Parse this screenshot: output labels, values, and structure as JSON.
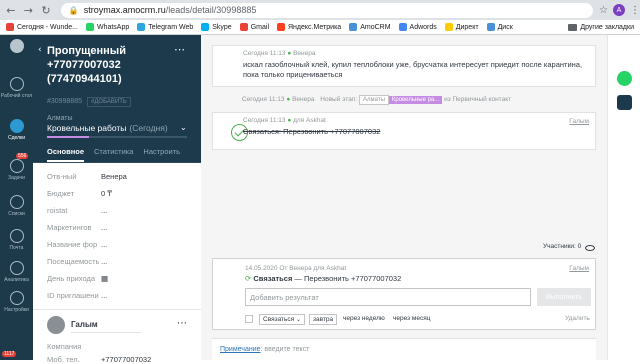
{
  "browser": {
    "url_domain": "stroymax.amocrm.ru",
    "url_path": "/leads/detail/30998885",
    "profile_initial": "A",
    "bookmarks": [
      {
        "label": "Сегодня - Wunde...",
        "color": "#e5423a"
      },
      {
        "label": "WhatsApp",
        "color": "#25d366"
      },
      {
        "label": "Telegram Web",
        "color": "#2ca5e0"
      },
      {
        "label": "Skype",
        "color": "#00aff0"
      },
      {
        "label": "Gmail",
        "color": "#ea4335"
      },
      {
        "label": "Яндекс.Метрика",
        "color": "#fc3f1d"
      },
      {
        "label": "AmoCRM",
        "color": "#4a90d9"
      },
      {
        "label": "Adwords",
        "color": "#4285f4"
      },
      {
        "label": "Директ",
        "color": "#ffcc00"
      },
      {
        "label": "Диск",
        "color": "#4a90d9"
      }
    ],
    "other_bookmarks": "Другие закладки"
  },
  "leftnav": {
    "items": [
      {
        "label": "Рабочий стол"
      },
      {
        "label": "Сделки"
      },
      {
        "label": "Задачи",
        "badge": "556"
      },
      {
        "label": "Списки"
      },
      {
        "label": "Почта"
      },
      {
        "label": "Аналитика"
      },
      {
        "label": "Настройки"
      }
    ],
    "bottom_badge": "1117"
  },
  "lead": {
    "title": "Пропущенный +77077007032 (77470944101)",
    "id": "#30998885",
    "tag_button": "#ДОБАВИТЬ",
    "pipeline": "Алматы",
    "stage": "Кровельные работы",
    "stage_date": "(Сегодня)",
    "stage_progress": 0.3,
    "tabs": [
      "Основное",
      "Статистика",
      "Настроить"
    ],
    "fields": [
      {
        "label": "Отв-ный",
        "value": "Венера"
      },
      {
        "label": "Бюджет",
        "value": "0 ₸"
      },
      {
        "label": "roistat",
        "value": "..."
      },
      {
        "label": "Маркетингов",
        "value": "..."
      },
      {
        "label": "Название фор",
        "value": "..."
      },
      {
        "label": "Посещаемость",
        "value": "..."
      },
      {
        "label": "День прихода",
        "value": "▦"
      },
      {
        "label": "ID приглашени",
        "value": "..."
      }
    ],
    "contact_name": "Галым",
    "contact_company_label": "Компания",
    "contact_phone_label": "Моб. тел.",
    "contact_phone": "+77077007032"
  },
  "feed": {
    "note": {
      "time": "Сегодня 11:13",
      "author": "Венера",
      "text": "искал газоблочный клей, купил теплоблоки уже, брусчатка интересует приедит после карантина, пока только прицениваеться"
    },
    "stage_change": {
      "time": "Сегодня 11:13",
      "author": "Венера",
      "label": "Новый этап:",
      "pipeline": "Алматы",
      "stage": "Кровельные ра...",
      "from": "из Первичный контакт"
    },
    "done_task": {
      "time": "Сегодня 11:13",
      "for": "для Askhat",
      "text": "Связаться: Перезвонить +77077007032",
      "assignee": "Галым"
    },
    "participants": "Участники: 0",
    "open_task": {
      "date": "14.05.2020",
      "from": "От Венера для Askhat",
      "type": "Связаться",
      "text": "— Перезвонить +77077007032",
      "assignee": "Галым"
    },
    "task_form": {
      "placeholder": "Добавить результат",
      "execute": "Выполнить",
      "select": "Связаться",
      "tomorrow": "завтра",
      "week": "через неделю",
      "month": "через месяц",
      "delete": "Удалить"
    },
    "note_bar": {
      "label": "Примечание",
      "placeholder": ": введите текст"
    }
  }
}
